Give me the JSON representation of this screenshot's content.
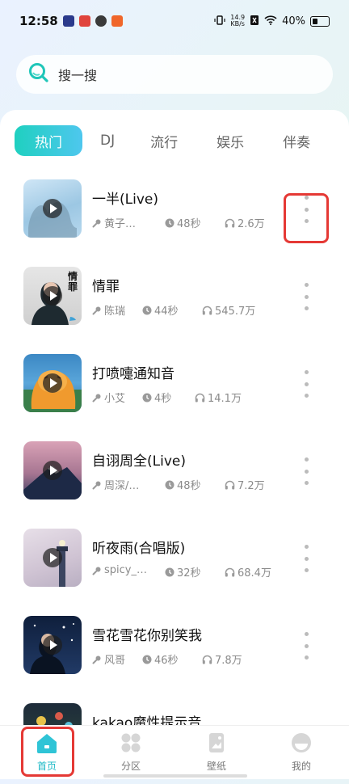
{
  "status": {
    "time": "12:58",
    "netspeed_value": "14.9",
    "netspeed_unit": "KB/s",
    "battery": "40%"
  },
  "search": {
    "placeholder": "搜一搜"
  },
  "tabs": [
    {
      "label": "热门",
      "active": true
    },
    {
      "label": "DJ",
      "active": false
    },
    {
      "label": "流行",
      "active": false
    },
    {
      "label": "娱乐",
      "active": false
    },
    {
      "label": "伴奏",
      "active": false
    }
  ],
  "songs": [
    {
      "title": "一半(Live)",
      "artist": "黄子…",
      "duration": "48秒",
      "plays": "2.6万"
    },
    {
      "title": "情罪",
      "artist": "陈瑞",
      "duration": "44秒",
      "plays": "545.7万"
    },
    {
      "title": "打喷嚏通知音",
      "artist": "小艾",
      "duration": "4秒",
      "plays": "14.1万"
    },
    {
      "title": "自诩周全(Live)",
      "artist": "周深/…",
      "duration": "48秒",
      "plays": "7.2万"
    },
    {
      "title": "听夜雨(合唱版)",
      "artist": "spicy_…",
      "duration": "32秒",
      "plays": "68.4万"
    },
    {
      "title": "雪花雪花你别笑我",
      "artist": "风哥",
      "duration": "46秒",
      "plays": "7.8万"
    },
    {
      "title": "kakao魔性提示音"
    }
  ],
  "cover_labels": {
    "song2": "情罪"
  },
  "nav": [
    {
      "label": "首页",
      "icon": "home-icon",
      "active": true
    },
    {
      "label": "分区",
      "icon": "grid-icon",
      "active": false
    },
    {
      "label": "壁纸",
      "icon": "wallpaper-icon",
      "active": false
    },
    {
      "label": "我的",
      "icon": "profile-icon",
      "active": false
    }
  ],
  "colors": {
    "accent": "#1bb8c6",
    "tab_gradient_start": "#1fd0c0",
    "tab_gradient_end": "#4ec7ee",
    "highlight": "#e53935"
  }
}
